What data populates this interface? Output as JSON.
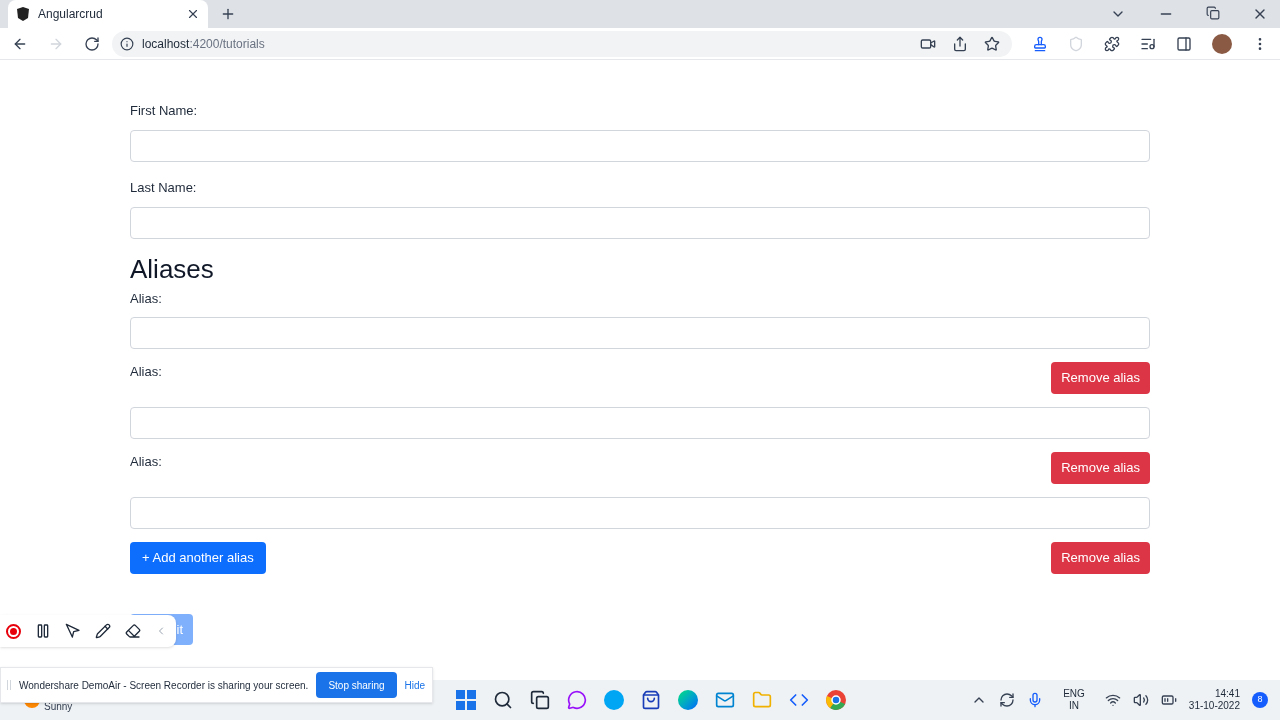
{
  "browser": {
    "tab_title": "Angularcrud",
    "url_host": "localhost",
    "url_path": ":4200/tutorials"
  },
  "form": {
    "fields": [
      {
        "label": "First Name:"
      },
      {
        "label": "Last Name:"
      }
    ],
    "aliases_heading": "Aliases",
    "aliases": [
      {
        "label": "Alias:"
      },
      {
        "label": "Alias:",
        "remove_label": "Remove alias"
      },
      {
        "label": "Alias:",
        "remove_label": "Remove alias"
      }
    ],
    "add_button": "+ Add another alias",
    "last_remove": "Remove alias",
    "submit_visible_text": "it"
  },
  "share_bar": {
    "message": "Wondershare DemoAir - Screen Recorder is sharing your screen.",
    "stop": "Stop sharing",
    "hide": "Hide"
  },
  "taskbar": {
    "weather": "Sunny",
    "lang": "ENG",
    "region": "IN",
    "time": "14:41",
    "date": "31-10-2022",
    "notifications": "8"
  }
}
